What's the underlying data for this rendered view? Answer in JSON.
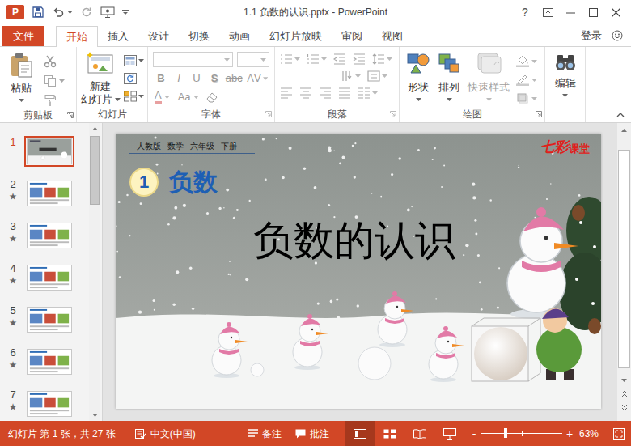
{
  "window": {
    "title": "1.1 负数的认识.pptx - PowerPoint",
    "app_logo": "P",
    "help": "?"
  },
  "file_tab": {
    "label": "文件"
  },
  "ribbon_tabs": [
    {
      "label": "开始",
      "selected": true
    },
    {
      "label": "插入",
      "selected": false
    },
    {
      "label": "设计",
      "selected": false
    },
    {
      "label": "切换",
      "selected": false
    },
    {
      "label": "动画",
      "selected": false
    },
    {
      "label": "幻灯片放映",
      "selected": false
    },
    {
      "label": "审阅",
      "selected": false
    },
    {
      "label": "视图",
      "selected": false
    }
  ],
  "account": {
    "label": "登录"
  },
  "ribbon": {
    "clipboard": {
      "label": "剪贴板",
      "paste": "粘贴"
    },
    "slides": {
      "label": "幻灯片",
      "new_slide": [
        "新建",
        "幻灯片"
      ]
    },
    "font": {
      "label": "字体",
      "disabled": true,
      "style_buttons": [
        {
          "label": "B",
          "kind": "bold"
        },
        {
          "label": "I",
          "kind": "italic"
        },
        {
          "label": "U",
          "kind": "underline"
        },
        {
          "label": "S",
          "kind": "shadow"
        },
        {
          "label": "abc",
          "kind": "strike"
        },
        {
          "label": "AV",
          "kind": "spacing"
        }
      ],
      "color_buttons": [
        {
          "label": "A",
          "kind": "color"
        },
        {
          "label": "Aa",
          "kind": "case"
        }
      ]
    },
    "paragraph": {
      "label": "段落",
      "disabled": true
    },
    "drawing": {
      "label": "绘图",
      "buttons": [
        {
          "label": "形状",
          "disabled": false,
          "kind": "shapes"
        },
        {
          "label": "排列",
          "disabled": false,
          "kind": "arrange"
        },
        {
          "label": "快速样式",
          "disabled": true,
          "kind": "styles"
        }
      ]
    },
    "editing": {
      "label": "编辑"
    }
  },
  "thumbnails": {
    "star": "★",
    "items": [
      {
        "number": "1",
        "selected": true,
        "starred": false,
        "kind": "title"
      },
      {
        "number": "2",
        "selected": false,
        "starred": true,
        "kind": "content"
      },
      {
        "number": "3",
        "selected": false,
        "starred": true,
        "kind": "content"
      },
      {
        "number": "4",
        "selected": false,
        "starred": true,
        "kind": "content"
      },
      {
        "number": "5",
        "selected": false,
        "starred": true,
        "kind": "content"
      },
      {
        "number": "6",
        "selected": false,
        "starred": true,
        "kind": "content"
      },
      {
        "number": "7",
        "selected": false,
        "starred": true,
        "kind": "content"
      }
    ]
  },
  "slide": {
    "header": [
      "人教版",
      "数学",
      "六年级",
      "下册"
    ],
    "logo": [
      "七彩",
      "课堂"
    ],
    "unit_number": "1",
    "unit_title": "负数",
    "title": "负数的认识"
  },
  "status_bar": {
    "slide_info": "幻灯片 第 1 张，共 27 张",
    "language": "中文(中国)",
    "notes": "备注",
    "comments": "批注",
    "views": [
      {
        "kind": "normal",
        "selected": true
      },
      {
        "kind": "sorter",
        "selected": false
      },
      {
        "kind": "reading",
        "selected": false
      },
      {
        "kind": "slideshow",
        "selected": false
      }
    ],
    "zoom_out": "-",
    "zoom_in": "+",
    "zoom_level": 0.3,
    "zoom": "63%"
  }
}
